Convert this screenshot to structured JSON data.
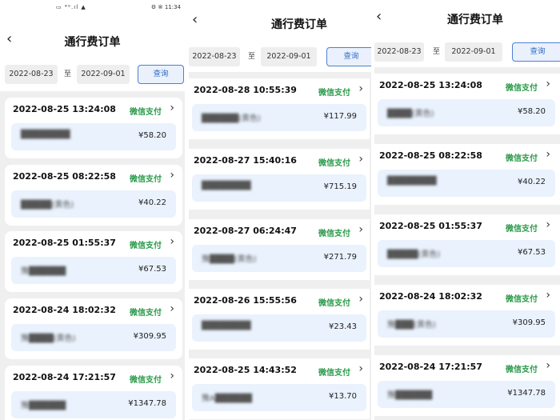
{
  "screens": [
    {
      "status": {
        "left": "▭ ⁴ᴳ.ıl ▲",
        "right": "⚙ ⑧ 11:34"
      },
      "title": "通行费订单",
      "date_start": "2022-08-23",
      "to_label": "至",
      "date_end": "2022-09-01",
      "query_label": "查询",
      "orders": [
        {
          "time": "2022-08-25 13:24:08",
          "pay": "微信支付",
          "plate": "████████",
          "amount": "¥58.20"
        },
        {
          "time": "2022-08-25 08:22:58",
          "pay": "微信支付",
          "plate": "█████(黄色)",
          "amount": "¥40.22"
        },
        {
          "time": "2022-08-25 01:55:37",
          "pay": "微信支付",
          "plate": "豫██████",
          "amount": "¥67.53"
        },
        {
          "time": "2022-08-24 18:02:32",
          "pay": "微信支付",
          "plate": "豫████(黄色)",
          "amount": "¥309.95"
        },
        {
          "time": "2022-08-24 17:21:57",
          "pay": "微信支付",
          "plate": "豫██████",
          "amount": "¥1347.78"
        }
      ]
    },
    {
      "title": "通行费订单",
      "date_start": "2022-08-23",
      "to_label": "至",
      "date_end": "2022-09-01",
      "query_label": "查询",
      "orders": [
        {
          "time": "2022-08-28 10:55:39",
          "pay": "微信支付",
          "plate": "██████(黄色)",
          "amount": "¥117.99"
        },
        {
          "time": "2022-08-27 15:40:16",
          "pay": "微信支付",
          "plate": "████████",
          "amount": "¥715.19"
        },
        {
          "time": "2022-08-27 06:24:47",
          "pay": "微信支付",
          "plate": "豫████(黄色)",
          "amount": "¥271.79"
        },
        {
          "time": "2022-08-26 15:55:56",
          "pay": "微信支付",
          "plate": "████████",
          "amount": "¥23.43"
        },
        {
          "time": "2022-08-25 14:43:52",
          "pay": "微信支付",
          "plate": "豫A██████",
          "amount": "¥13.70"
        }
      ]
    },
    {
      "title": "通行费订单",
      "date_start": "2022-08-23",
      "to_label": "至",
      "date_end": "2022-09-01",
      "query_label": "查询",
      "orders": [
        {
          "time": "2022-08-25 13:24:08",
          "pay": "微信支付",
          "plate": "████(黄色)",
          "amount": "¥58.20"
        },
        {
          "time": "2022-08-25 08:22:58",
          "pay": "微信支付",
          "plate": "████████",
          "amount": "¥40.22"
        },
        {
          "time": "2022-08-25 01:55:37",
          "pay": "微信支付",
          "plate": "█████(黄色)",
          "amount": "¥67.53"
        },
        {
          "time": "2022-08-24 18:02:32",
          "pay": "微信支付",
          "plate": "豫███(黄色)",
          "amount": "¥309.95"
        },
        {
          "time": "2022-08-24 17:21:57",
          "pay": "微信支付",
          "plate": "豫██████",
          "amount": "¥1347.78"
        }
      ]
    }
  ]
}
